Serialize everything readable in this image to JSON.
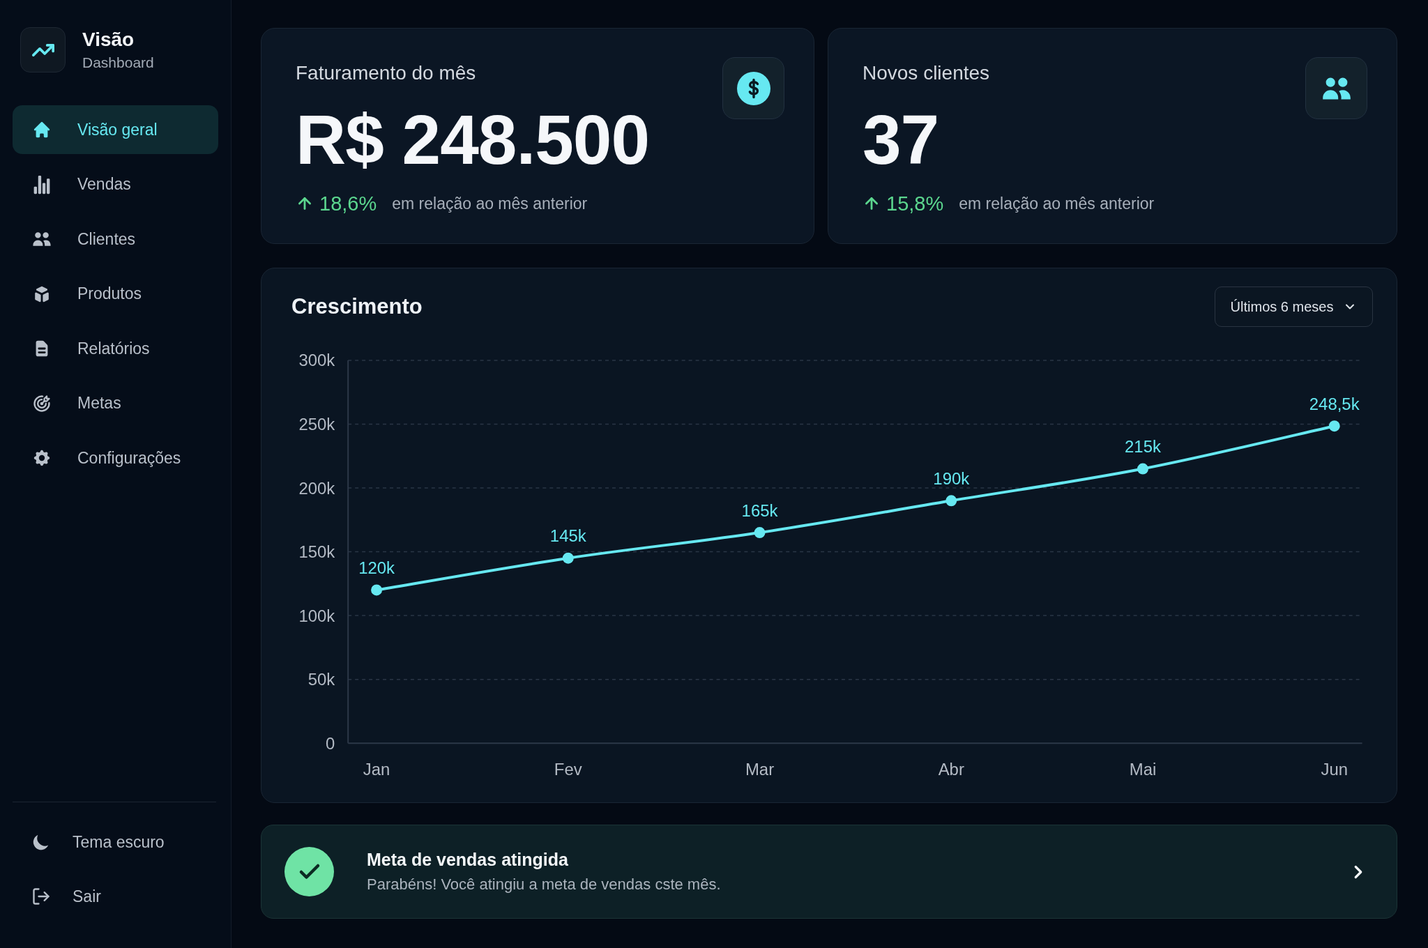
{
  "sidebar": {
    "brand": {
      "title": "Visão",
      "subtitle": "Dashboard"
    },
    "nav_items": [
      {
        "label": "Visão geral",
        "selected": true
      },
      {
        "label": "Vendas",
        "selected": false
      },
      {
        "label": "Clientes",
        "selected": false
      },
      {
        "label": "Produtos",
        "selected": false
      },
      {
        "label": "Relatórios",
        "selected": false
      },
      {
        "label": "Metas",
        "selected": false
      },
      {
        "label": "Configurações",
        "selected": false
      }
    ],
    "footer_items": [
      {
        "label": "Tema escuro"
      },
      {
        "label": "Sair"
      }
    ]
  },
  "stat_cards": [
    {
      "title": "Faturamento do mês",
      "value": "R$ 248.500",
      "change": "18,6%",
      "change_note": "em relação ao mês anterior"
    },
    {
      "title": "Novos clientes",
      "value": "37",
      "change": "15,8%",
      "change_note": "em relação ao mês anterior"
    }
  ],
  "growth_chart": {
    "title": "Crescimento",
    "period_select": {
      "value": "Últimos 6 meses"
    },
    "chart_data": {
      "type": "line",
      "categories": [
        "Jan",
        "Fev",
        "Mar",
        "Abr",
        "Mai",
        "Jun"
      ],
      "values": [
        120,
        145,
        165,
        190,
        215,
        248.5
      ],
      "ylim": [
        0,
        300
      ],
      "yticks": [
        {
          "value": 0,
          "label": "0"
        },
        {
          "value": 50,
          "label": "50k"
        },
        {
          "value": 100,
          "label": "100k"
        },
        {
          "value": 150,
          "label": "150k"
        },
        {
          "value": 200,
          "label": "200k"
        },
        {
          "value": 250,
          "label": "250k"
        },
        {
          "value": 300,
          "label": "300k"
        }
      ],
      "grid": true,
      "marker": true,
      "value_labels": [
        "120k",
        "145k",
        "165k",
        "190k",
        "215k",
        "248,5k"
      ]
    }
  },
  "notification": {
    "title": "Meta de vendas atingida",
    "message": "Parabéns! Você atingiu a meta de vendas cste mês."
  }
}
